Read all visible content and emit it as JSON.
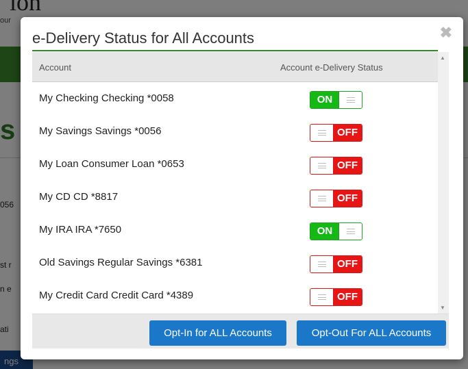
{
  "background": {
    "logo_text": "ion",
    "logo_sub": "our",
    "big_letter": "s",
    "side_texts": [
      "056",
      "st r",
      "n e",
      "ati"
    ],
    "bottom_button": "ngs"
  },
  "modal": {
    "title": "e-Delivery Status for All Accounts",
    "close_symbol": "✖",
    "table": {
      "headers": {
        "account": "Account",
        "status": "Account e-Delivery Status"
      },
      "rows": [
        {
          "account": "My Checking Checking *0058",
          "status": "ON"
        },
        {
          "account": "My Savings Savings *0056",
          "status": "OFF"
        },
        {
          "account": "My Loan Consumer Loan *0653",
          "status": "OFF"
        },
        {
          "account": "My CD CD *8817",
          "status": "OFF"
        },
        {
          "account": "My IRA IRA *7650",
          "status": "ON"
        },
        {
          "account": "Old Savings Regular Savings *6381",
          "status": "OFF"
        },
        {
          "account": "My Credit Card Credit Card *4389",
          "status": "OFF"
        }
      ]
    },
    "buttons": {
      "opt_in": "Opt-In for ALL Accounts",
      "opt_out": "Opt-Out For ALL Accounts"
    }
  },
  "colors": {
    "on": "#16b816",
    "off": "#e61616",
    "button": "#1b78c8",
    "title_rule": "#2f8a23"
  }
}
